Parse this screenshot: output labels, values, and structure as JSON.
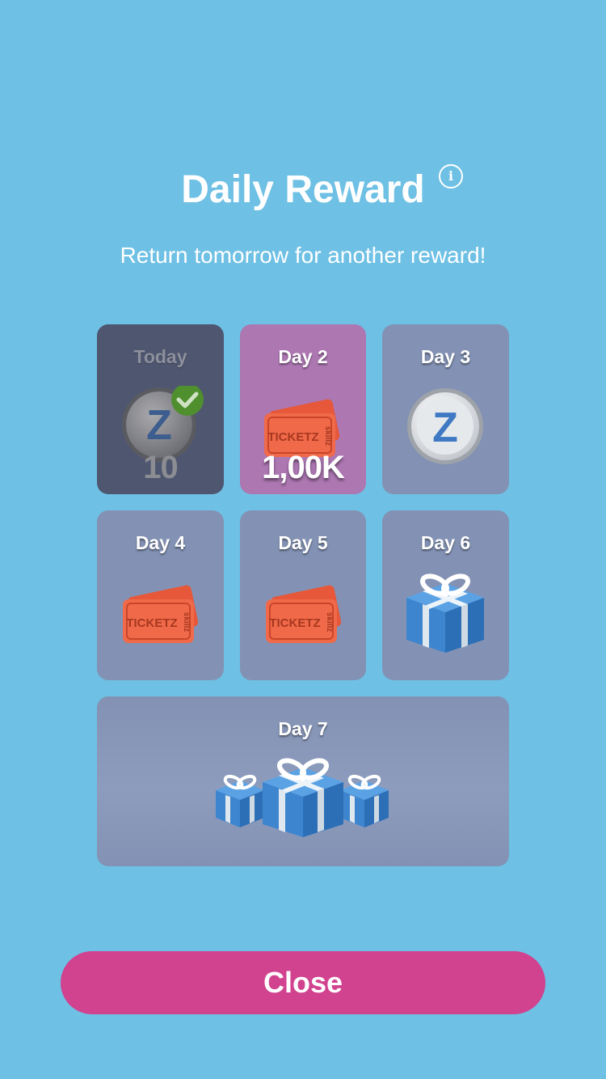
{
  "header": {
    "title": "Daily Reward",
    "info_icon": "info-icon",
    "info_glyph": "i",
    "subtitle": "Return tomorrow for another reward!"
  },
  "rewards": [
    {
      "label": "Today",
      "reward": "z-coin",
      "amount": "10",
      "claimed": true
    },
    {
      "label": "Day 2",
      "reward": "tickets",
      "amount": "1,00K",
      "current": true
    },
    {
      "label": "Day 3",
      "reward": "z-coin"
    },
    {
      "label": "Day 4",
      "reward": "tickets"
    },
    {
      "label": "Day 5",
      "reward": "tickets"
    },
    {
      "label": "Day 6",
      "reward": "gift-box"
    },
    {
      "label": "Day 7",
      "reward": "gift-boxes"
    }
  ],
  "ticket_text": "TICKETZ",
  "ticket_side_text": "skillz",
  "coin_letter": "Z",
  "footer": {
    "close_label": "Close"
  },
  "colors": {
    "background": "#6ec0e4",
    "card": "#8392b4",
    "card_today": "#4e5670",
    "card_current": "#ad77b2",
    "close_button": "#d1428f",
    "ticket": "#f06a4a",
    "gift": "#3d86cf",
    "check": "#4f8f2e"
  }
}
